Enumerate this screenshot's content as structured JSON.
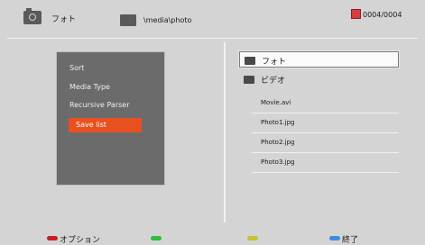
{
  "header": {
    "source_label": "フォト",
    "path": "\\media\\photo",
    "counter": "0004/0004"
  },
  "menu": {
    "items": [
      {
        "label": "Sort"
      },
      {
        "label": "Media Type"
      },
      {
        "label": "Recursive Parser"
      },
      {
        "label": "Save list",
        "selected": true
      }
    ]
  },
  "file_list": {
    "folders": [
      {
        "name": "フォト",
        "focused": true
      },
      {
        "name": "ビデオ",
        "focused": false
      }
    ],
    "files": [
      "Movie.avi",
      "Photo1.jpg",
      "Photo2.jpg",
      "Photo3.jpg"
    ]
  },
  "footer": {
    "red_label": "オプション",
    "green_label": "",
    "yellow_label": "",
    "blue_label": "終了"
  },
  "colors": {
    "background": "#d4d4d4",
    "menu_panel": "#6b6b6b",
    "highlight": "#e8501f",
    "red_button": "#c62020",
    "green_button": "#2bbf3a",
    "yellow_button": "#c8c23a",
    "blue_button": "#3a8ee0"
  }
}
